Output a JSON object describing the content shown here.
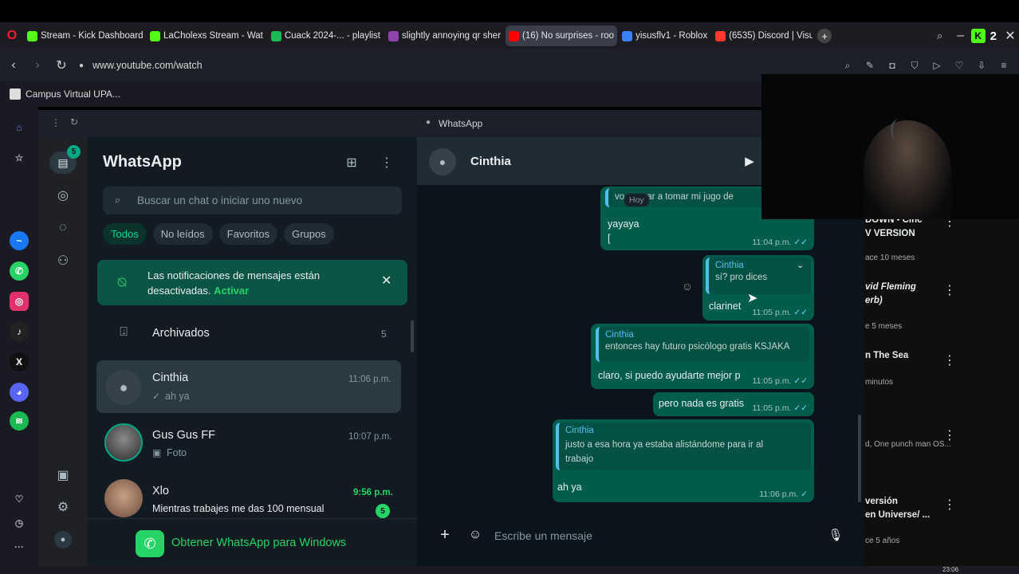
{
  "browser": {
    "tabs": [
      {
        "label": "Stream - Kick Dashboard",
        "color": "#53fc18"
      },
      {
        "label": "LaCholexs Stream - Wat",
        "color": "#53fc18"
      },
      {
        "label": "Cuack 2024-... - playlist",
        "color": "#1db954"
      },
      {
        "label": "slightly annoying qr sher",
        "color": "#8e44ad"
      },
      {
        "label": "(16) No surprises - roo",
        "color": "#ff0000"
      },
      {
        "label": "yisusflv1 - Roblox",
        "color": "#3b82f6"
      },
      {
        "label": "(6535) Discord | Visus, Sa",
        "color": "#ff3b30"
      }
    ],
    "kick_count": "2",
    "url": "www.youtube.com/watch",
    "bookmark": "Campus Virtual UPA...",
    "panel_title": "WhatsApp",
    "taskbar_time": "23:06"
  },
  "whatsapp": {
    "app_title": "WhatsApp",
    "chats_badge": "5",
    "search_placeholder": "Buscar un chat o iniciar uno nuevo",
    "filters": [
      "Todos",
      "No leídos",
      "Favoritos",
      "Grupos"
    ],
    "notice_text": "Las notificaciones de mensajes están desactivadas.",
    "notice_link": "Activar",
    "archived_label": "Archivados",
    "archived_count": "5",
    "chats": [
      {
        "name": "Cinthia",
        "time": "11:06 p.m.",
        "preview": "ah ya",
        "prefix": "✓"
      },
      {
        "name": "Gus Gus FF",
        "time": "10:07 p.m.",
        "preview": "Foto",
        "prefix": "▣"
      },
      {
        "name": "Xlo",
        "time": "9:56 p.m.",
        "preview": "Mientras trabajes me das 100 mensual",
        "unread": "5"
      }
    ],
    "get_app": "Obtener WhatsApp para Windows",
    "conversation": {
      "contact": "Cinthia",
      "date_chip": "Hoy",
      "composer_placeholder": "Escribe un mensaje",
      "messages": [
        {
          "quote": "vo...pezar a tomar mi jugo de",
          "text": "yayaya\n[",
          "time": "11:04 p.m."
        },
        {
          "quote_name": "Cinthia",
          "quote": "sí? pro dices",
          "text": "clarinet",
          "time": "11:05 p.m."
        },
        {
          "quote_name": "Cinthia",
          "quote": "entonces hay futuro psicólogo gratis KSJAKA",
          "text": "claro, si puedo ayudarte mejor p",
          "time": "11:05 p.m."
        },
        {
          "text": "pero nada es gratis",
          "time": "11:05 p.m."
        },
        {
          "quote_name": "Cinthia",
          "quote": "justo a esa hora ya estaba alistándome para ir al trabajo",
          "text": "ah ya",
          "time": "11:06 p.m."
        }
      ]
    }
  },
  "youtube_side": {
    "items": [
      {
        "title": "DOWN - Cinc\nV VERSION",
        "meta": "ace 10 meses"
      },
      {
        "title": "vid Fleming\nerb)",
        "meta": "e 5 meses"
      },
      {
        "title": "n The Sea",
        "meta": "minutos"
      },
      {
        "title": "",
        "meta": "d, One punch man OS..."
      },
      {
        "title": "versión\nen Universe/ ...",
        "meta": "ce 5 años"
      }
    ]
  },
  "colors": {
    "accent": "#00a884",
    "bubble": "#005c4b",
    "bg": "#0b141a"
  }
}
